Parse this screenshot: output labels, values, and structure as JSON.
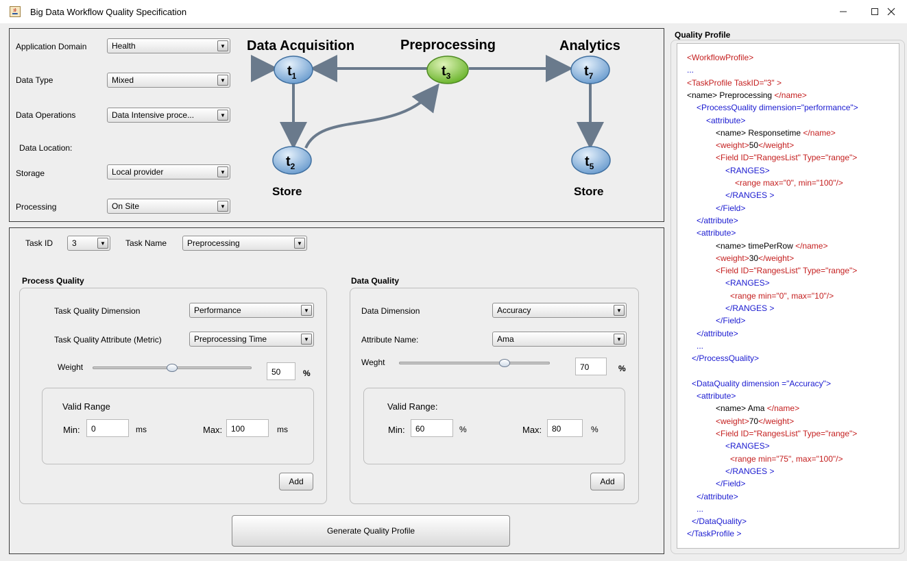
{
  "window": {
    "title": "Big Data Workflow Quality Specification"
  },
  "config": {
    "domain_label": "Application Domain",
    "domain_value": "Health",
    "type_label": "Data Type",
    "type_value": "Mixed",
    "ops_label": "Data Operations",
    "ops_value": "Data Intensive proce...",
    "location_label": "Data Location:",
    "storage_label": "Storage",
    "storage_value": "Local provider",
    "processing_label": "Processing",
    "processing_value": "On Site"
  },
  "workflow": {
    "acq_label": "Data Acquisition",
    "pre_label": "Preprocessing",
    "ana_label": "Analytics",
    "store1_label": "Store",
    "store2_label": "Store",
    "nodes": [
      {
        "id": "t1",
        "base": "t",
        "sub": "1",
        "color": "#9ec4e8"
      },
      {
        "id": "t3",
        "base": "t",
        "sub": "3",
        "color": "#8fd14f"
      },
      {
        "id": "t7",
        "base": "t",
        "sub": "7",
        "color": "#9ec4e8"
      },
      {
        "id": "t2",
        "base": "t",
        "sub": "2",
        "color": "#9ec4e8"
      },
      {
        "id": "t5",
        "base": "t",
        "sub": "5",
        "color": "#9ec4e8"
      }
    ]
  },
  "task": {
    "id_label": "Task ID",
    "id_value": "3",
    "name_label": "Task Name",
    "name_value": "Preprocessing"
  },
  "process_quality": {
    "header": "Process Quality",
    "dimension_label": "Task Quality Dimension",
    "dimension_value": "Performance",
    "attribute_label": "Task Quality Attribute (Metric)",
    "attribute_value": "Preprocessing Time",
    "weight_label": "Weight",
    "weight_value": "50",
    "weight_unit": "%",
    "weight_fraction": 0.5,
    "range_title": "Valid Range",
    "min_label": "Min:",
    "min_value": "0",
    "min_unit": "ms",
    "max_label": "Max:",
    "max_value": "100",
    "max_unit": "ms",
    "add_label": "Add"
  },
  "data_quality": {
    "header": "Data Quality",
    "dimension_label": "Data Dimension",
    "dimension_value": "Accuracy",
    "attribute_label": "Attribute Name:",
    "attribute_value": "Ama",
    "weight_label": "Weght",
    "weight_value": "70",
    "weight_unit": "%",
    "weight_fraction": 0.7,
    "range_title": "Valid Range:",
    "min_label": "Min:",
    "min_value": "60",
    "min_unit": "%",
    "max_label": "Max:",
    "max_value": "80",
    "max_unit": "%",
    "add_label": "Add"
  },
  "generate_label": "Generate Quality Profile",
  "profile": {
    "title": "Quality Profile",
    "lines": [
      {
        "indent": 0,
        "parts": [
          {
            "t": "<WorkflowProfile>",
            "c": "red"
          }
        ]
      },
      {
        "indent": 0,
        "parts": [
          {
            "t": "...",
            "c": "blue"
          }
        ]
      },
      {
        "indent": 0,
        "parts": [
          {
            "t": "<TaskProfile TaskID=\"3\" >",
            "c": "red"
          }
        ]
      },
      {
        "indent": 0,
        "parts": [
          {
            "t": "<name>",
            "c": "dark"
          },
          {
            "t": " Preprocessing ",
            "c": "dark"
          },
          {
            "t": "</name>",
            "c": "red"
          }
        ]
      },
      {
        "indent": 1,
        "parts": [
          {
            "t": "<ProcessQuality dimension=\"performance\">",
            "c": "blue"
          }
        ]
      },
      {
        "indent": 2,
        "parts": [
          {
            "t": "<attribute>",
            "c": "blue"
          }
        ]
      },
      {
        "indent": 3,
        "parts": [
          {
            "t": "<name>",
            "c": "dark"
          },
          {
            "t": " Responsetime ",
            "c": "dark"
          },
          {
            "t": "</name>",
            "c": "red"
          }
        ]
      },
      {
        "indent": 3,
        "parts": [
          {
            "t": "<weight>",
            "c": "red"
          },
          {
            "t": "50",
            "c": "dark"
          },
          {
            "t": "</weight>",
            "c": "red"
          }
        ]
      },
      {
        "indent": 3,
        "parts": [
          {
            "t": "<Field ID=\"RangesList\" Type=\"range\">",
            "c": "red"
          }
        ]
      },
      {
        "indent": 4,
        "parts": [
          {
            "t": "<RANGES>",
            "c": "blue"
          }
        ]
      },
      {
        "indent": 5,
        "parts": [
          {
            "t": "<range max=\"0\", min=\"100\"/>",
            "c": "red"
          }
        ]
      },
      {
        "indent": 4,
        "parts": [
          {
            "t": "</RANGES >",
            "c": "blue"
          }
        ]
      },
      {
        "indent": 3,
        "parts": [
          {
            "t": "</Field>",
            "c": "blue"
          }
        ]
      },
      {
        "indent": 1,
        "parts": [
          {
            "t": "</attribute>",
            "c": "blue"
          }
        ]
      },
      {
        "indent": 1,
        "parts": [
          {
            "t": "<attribute>",
            "c": "blue"
          }
        ]
      },
      {
        "indent": 3,
        "parts": [
          {
            "t": "<name>",
            "c": "dark"
          },
          {
            "t": " timePerRow ",
            "c": "dark"
          },
          {
            "t": "</name>",
            "c": "red"
          }
        ]
      },
      {
        "indent": 3,
        "parts": [
          {
            "t": "<weight>",
            "c": "red"
          },
          {
            "t": "30",
            "c": "dark"
          },
          {
            "t": "</weight>",
            "c": "red"
          }
        ]
      },
      {
        "indent": 3,
        "parts": [
          {
            "t": "<Field ID=\"RangesList\" Type=\"range\">",
            "c": "red"
          }
        ]
      },
      {
        "indent": 4,
        "parts": [
          {
            "t": "<RANGES>",
            "c": "blue"
          }
        ]
      },
      {
        "indent": 4.5,
        "parts": [
          {
            "t": "<range min=\"0\", max=\"10\"/>",
            "c": "red"
          }
        ]
      },
      {
        "indent": 4,
        "parts": [
          {
            "t": "</RANGES >",
            "c": "blue"
          }
        ]
      },
      {
        "indent": 3,
        "parts": [
          {
            "t": "</Field>",
            "c": "blue"
          }
        ]
      },
      {
        "indent": 1,
        "parts": [
          {
            "t": "</attribute>",
            "c": "blue"
          }
        ]
      },
      {
        "indent": 1,
        "parts": [
          {
            "t": "...",
            "c": "blue"
          }
        ]
      },
      {
        "indent": 0.5,
        "parts": [
          {
            "t": "</ProcessQuality>",
            "c": "blue"
          }
        ]
      },
      {
        "indent": 0,
        "parts": [
          {
            "t": "",
            "c": "dark"
          }
        ]
      },
      {
        "indent": 0.5,
        "parts": [
          {
            "t": "<DataQuality dimension =\"Accuracy\">",
            "c": "blue"
          }
        ]
      },
      {
        "indent": 1,
        "parts": [
          {
            "t": "<attribute>",
            "c": "blue"
          }
        ]
      },
      {
        "indent": 3,
        "parts": [
          {
            "t": "<name>",
            "c": "dark"
          },
          {
            "t": " Ama ",
            "c": "dark"
          },
          {
            "t": "</name>",
            "c": "red"
          }
        ]
      },
      {
        "indent": 3,
        "parts": [
          {
            "t": "<weight>",
            "c": "red"
          },
          {
            "t": "70",
            "c": "dark"
          },
          {
            "t": "</weight>",
            "c": "red"
          }
        ]
      },
      {
        "indent": 3,
        "parts": [
          {
            "t": "<Field ID=\"RangesList\" Type=\"range\">",
            "c": "red"
          }
        ]
      },
      {
        "indent": 4,
        "parts": [
          {
            "t": "<RANGES>",
            "c": "blue"
          }
        ]
      },
      {
        "indent": 4.5,
        "parts": [
          {
            "t": "<range min=\"75\", max=\"100\"/>",
            "c": "red"
          }
        ]
      },
      {
        "indent": 4,
        "parts": [
          {
            "t": "</RANGES >",
            "c": "blue"
          }
        ]
      },
      {
        "indent": 3,
        "parts": [
          {
            "t": "</Field>",
            "c": "blue"
          }
        ]
      },
      {
        "indent": 1,
        "parts": [
          {
            "t": "</attribute>",
            "c": "blue"
          }
        ]
      },
      {
        "indent": 1,
        "parts": [
          {
            "t": "...",
            "c": "blue"
          }
        ]
      },
      {
        "indent": 0.5,
        "parts": [
          {
            "t": "</DataQuality>",
            "c": "blue"
          }
        ]
      },
      {
        "indent": 0,
        "parts": [
          {
            "t": "</TaskProfile >",
            "c": "blue"
          }
        ]
      }
    ]
  }
}
